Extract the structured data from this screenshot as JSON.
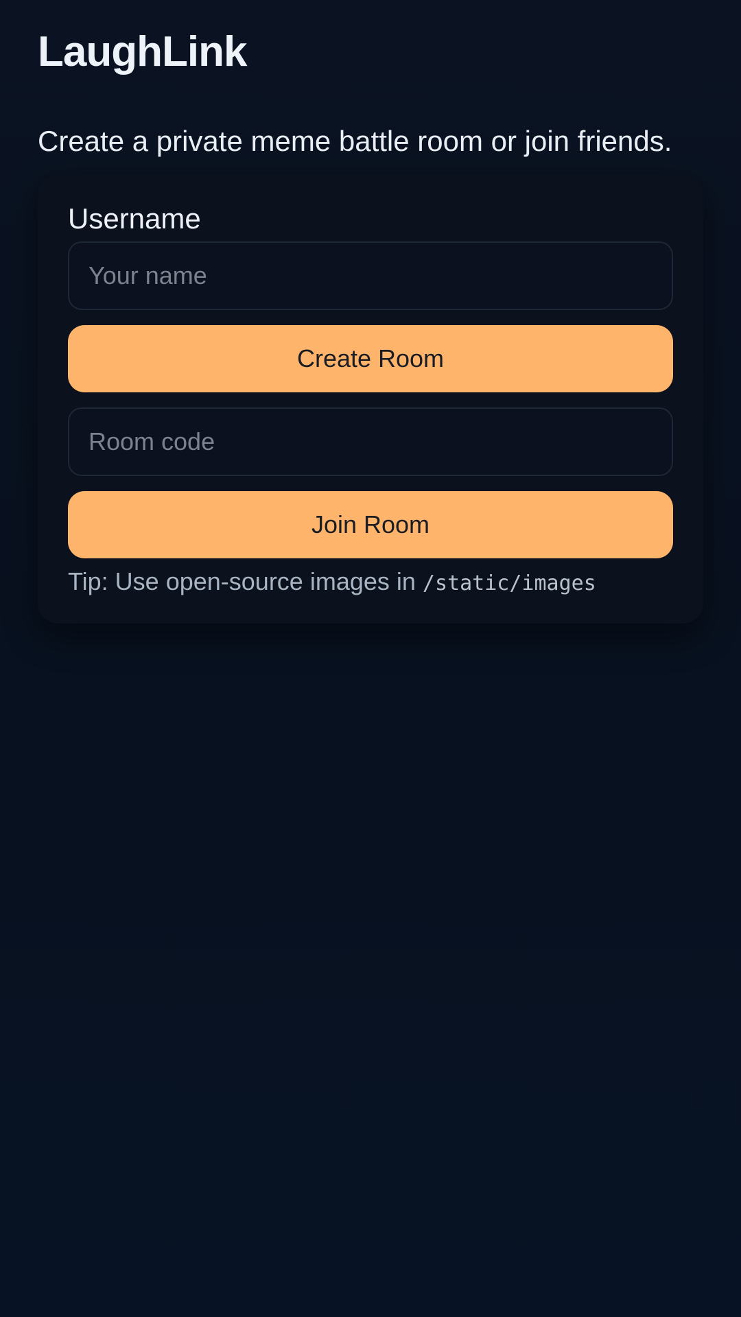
{
  "header": {
    "title": "LaughLink",
    "subtitle": "Create a private meme battle room or join friends."
  },
  "form": {
    "username_label": "Username",
    "username_placeholder": "Your name",
    "create_button": "Create Room",
    "room_code_placeholder": "Room code",
    "join_button": "Join Room",
    "tip_text": "Tip: Use open-source images in ",
    "tip_path": "/static/images"
  },
  "colors": {
    "background": "#0b1322",
    "card": "#0b111d",
    "accent": "#ffb46c"
  }
}
